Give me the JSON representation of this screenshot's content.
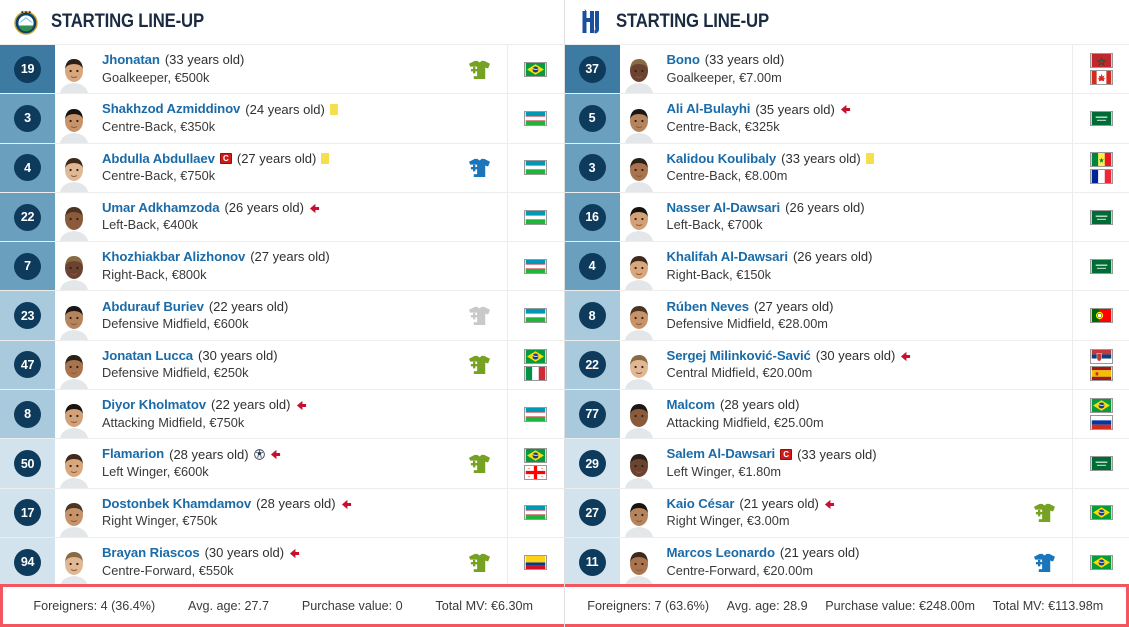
{
  "teams": [
    {
      "side": "left",
      "crest_icon": "pakhtakor-crest-icon",
      "title": "STARTING LINE-UP",
      "players": [
        {
          "number": "19",
          "name": "Jhonatan",
          "age": "(33 years old)",
          "detail": "Goalkeeper, €500k",
          "captain": false,
          "yellow_card": false,
          "red_arrow": false,
          "goal": false,
          "sub_icon": "green-shirt-in-icon",
          "flags": [
            "brazil"
          ],
          "row_shade": "#3d7ba3"
        },
        {
          "number": "3",
          "name": "Shakhzod Azmiddinov",
          "age": "(24 years old)",
          "detail": "Centre-Back, €350k",
          "captain": false,
          "yellow_card": true,
          "red_arrow": false,
          "goal": false,
          "sub_icon": "none",
          "flags": [
            "uzbekistan"
          ],
          "row_shade": "#6a9fbe"
        },
        {
          "number": "4",
          "name": "Abdulla Abdullaev",
          "age": "(27 years old)",
          "detail": "Centre-Back, €750k",
          "captain": true,
          "yellow_card": true,
          "red_arrow": false,
          "goal": false,
          "sub_icon": "blue-shirt-out-icon",
          "flags": [
            "uzbekistan"
          ],
          "row_shade": "#6a9fbe"
        },
        {
          "number": "22",
          "name": "Umar Adkhamzoda",
          "age": "(26 years old)",
          "detail": "Left-Back, €400k",
          "captain": false,
          "yellow_card": false,
          "red_arrow": true,
          "goal": false,
          "sub_icon": "none",
          "flags": [
            "uzbekistan"
          ],
          "row_shade": "#6a9fbe"
        },
        {
          "number": "7",
          "name": "Khozhiakbar Alizhonov",
          "age": "(27 years old)",
          "detail": "Right-Back, €800k",
          "captain": false,
          "yellow_card": false,
          "red_arrow": false,
          "goal": false,
          "sub_icon": "none",
          "flags": [
            "uzbekistan"
          ],
          "row_shade": "#6a9fbe"
        },
        {
          "number": "23",
          "name": "Abdurauf Buriev",
          "age": "(22 years old)",
          "detail": "Defensive Midfield, €600k",
          "captain": false,
          "yellow_card": false,
          "red_arrow": false,
          "goal": false,
          "sub_icon": "grey-shirt-icon",
          "flags": [
            "uzbekistan"
          ],
          "row_shade": "#a9c9dc"
        },
        {
          "number": "47",
          "name": "Jonatan Lucca",
          "age": "(30 years old)",
          "detail": "Defensive Midfield, €250k",
          "captain": false,
          "yellow_card": false,
          "red_arrow": false,
          "goal": false,
          "sub_icon": "green-shirt-in-icon",
          "flags": [
            "brazil",
            "italy"
          ],
          "row_shade": "#a9c9dc"
        },
        {
          "number": "8",
          "name": "Diyor Kholmatov",
          "age": "(22 years old)",
          "detail": "Attacking Midfield, €750k",
          "captain": false,
          "yellow_card": false,
          "red_arrow": true,
          "goal": false,
          "sub_icon": "none",
          "flags": [
            "uzbekistan"
          ],
          "row_shade": "#a9c9dc"
        },
        {
          "number": "50",
          "name": "Flamarion",
          "age": "(28 years old)",
          "detail": "Left Winger, €600k",
          "captain": false,
          "yellow_card": false,
          "red_arrow": true,
          "goal": true,
          "sub_icon": "green-shirt-in-icon",
          "flags": [
            "brazil",
            "georgia"
          ],
          "row_shade": "#d3e3ee"
        },
        {
          "number": "17",
          "name": "Dostonbek Khamdamov",
          "age": "(28 years old)",
          "detail": "Right Winger, €750k",
          "captain": false,
          "yellow_card": false,
          "red_arrow": true,
          "goal": false,
          "sub_icon": "none",
          "flags": [
            "uzbekistan"
          ],
          "row_shade": "#d3e3ee"
        },
        {
          "number": "94",
          "name": "Brayan Riascos",
          "age": "(30 years old)",
          "detail": "Centre-Forward, €550k",
          "captain": false,
          "yellow_card": false,
          "red_arrow": true,
          "goal": false,
          "sub_icon": "green-shirt-in-icon",
          "flags": [
            "colombia"
          ],
          "row_shade": "#d3e3ee"
        }
      ],
      "stats": [
        "Foreigners: 4 (36.4%)",
        "Avg. age: 27.7",
        "Purchase value: 0",
        "Total MV: €6.30m"
      ]
    },
    {
      "side": "right",
      "crest_icon": "alhilal-crest-icon",
      "title": "STARTING LINE-UP",
      "players": [
        {
          "number": "37",
          "name": "Bono",
          "age": "(33 years old)",
          "detail": "Goalkeeper, €7.00m",
          "captain": false,
          "yellow_card": false,
          "red_arrow": false,
          "goal": false,
          "sub_icon": "none",
          "flags": [
            "morocco",
            "canada"
          ],
          "row_shade": "#3d7ba3"
        },
        {
          "number": "5",
          "name": "Ali Al-Bulayhi",
          "age": "(35 years old)",
          "detail": "Centre-Back, €325k",
          "captain": false,
          "yellow_card": false,
          "red_arrow": true,
          "goal": false,
          "sub_icon": "none",
          "flags": [
            "saudi"
          ],
          "row_shade": "#6a9fbe"
        },
        {
          "number": "3",
          "name": "Kalidou Koulibaly",
          "age": "(33 years old)",
          "detail": "Centre-Back, €8.00m",
          "captain": false,
          "yellow_card": true,
          "red_arrow": false,
          "goal": false,
          "sub_icon": "none",
          "flags": [
            "senegal",
            "france"
          ],
          "row_shade": "#6a9fbe"
        },
        {
          "number": "16",
          "name": "Nasser Al-Dawsari",
          "age": "(26 years old)",
          "detail": "Left-Back, €700k",
          "captain": false,
          "yellow_card": false,
          "red_arrow": false,
          "goal": false,
          "sub_icon": "none",
          "flags": [
            "saudi"
          ],
          "row_shade": "#6a9fbe"
        },
        {
          "number": "4",
          "name": "Khalifah Al-Dawsari",
          "age": "(26 years old)",
          "detail": "Right-Back, €150k",
          "captain": false,
          "yellow_card": false,
          "red_arrow": false,
          "goal": false,
          "sub_icon": "none",
          "flags": [
            "saudi"
          ],
          "row_shade": "#6a9fbe"
        },
        {
          "number": "8",
          "name": "Rúben Neves",
          "age": "(27 years old)",
          "detail": "Defensive Midfield, €28.00m",
          "captain": false,
          "yellow_card": false,
          "red_arrow": false,
          "goal": false,
          "sub_icon": "none",
          "flags": [
            "portugal"
          ],
          "row_shade": "#a9c9dc"
        },
        {
          "number": "22",
          "name": "Sergej Milinković-Savić",
          "age": "(30 years old)",
          "detail": "Central Midfield, €20.00m",
          "captain": false,
          "yellow_card": false,
          "red_arrow": true,
          "goal": false,
          "sub_icon": "none",
          "flags": [
            "serbia",
            "spain"
          ],
          "row_shade": "#a9c9dc"
        },
        {
          "number": "77",
          "name": "Malcom",
          "age": "(28 years old)",
          "detail": "Attacking Midfield, €25.00m",
          "captain": false,
          "yellow_card": false,
          "red_arrow": false,
          "goal": false,
          "sub_icon": "none",
          "flags": [
            "brazil",
            "russia"
          ],
          "row_shade": "#a9c9dc"
        },
        {
          "number": "29",
          "name": "Salem Al-Dawsari",
          "age": "(33 years old)",
          "detail": "Left Winger, €1.80m",
          "captain": true,
          "yellow_card": false,
          "red_arrow": false,
          "goal": false,
          "sub_icon": "none",
          "flags": [
            "saudi"
          ],
          "row_shade": "#d3e3ee"
        },
        {
          "number": "27",
          "name": "Kaio César",
          "age": "(21 years old)",
          "detail": "Right Winger, €3.00m",
          "captain": false,
          "yellow_card": false,
          "red_arrow": true,
          "goal": false,
          "sub_icon": "green-shirt-in-icon",
          "flags": [
            "brazil"
          ],
          "row_shade": "#d3e3ee"
        },
        {
          "number": "11",
          "name": "Marcos Leonardo",
          "age": "(21 years old)",
          "detail": "Centre-Forward, €20.00m",
          "captain": false,
          "yellow_card": false,
          "red_arrow": false,
          "goal": false,
          "sub_icon": "blue-shirt-out-icon",
          "flags": [
            "brazil"
          ],
          "row_shade": "#d3e3ee"
        }
      ],
      "stats": [
        "Foreigners: 7 (63.6%)",
        "Avg. age: 28.9",
        "Purchase value: €248.00m",
        "Total MV: €113.98m"
      ]
    }
  ],
  "colors": {
    "name_link": "#1a6ba8",
    "number_badge": "#0e3a5c",
    "highlight_border": "#f4565f",
    "green_sub": "#77a123",
    "blue_sub": "#1b75bb",
    "grey_sub": "#c9c9c9",
    "yellow_card": "#f4e04d",
    "red_arrow": "#c8102e"
  }
}
